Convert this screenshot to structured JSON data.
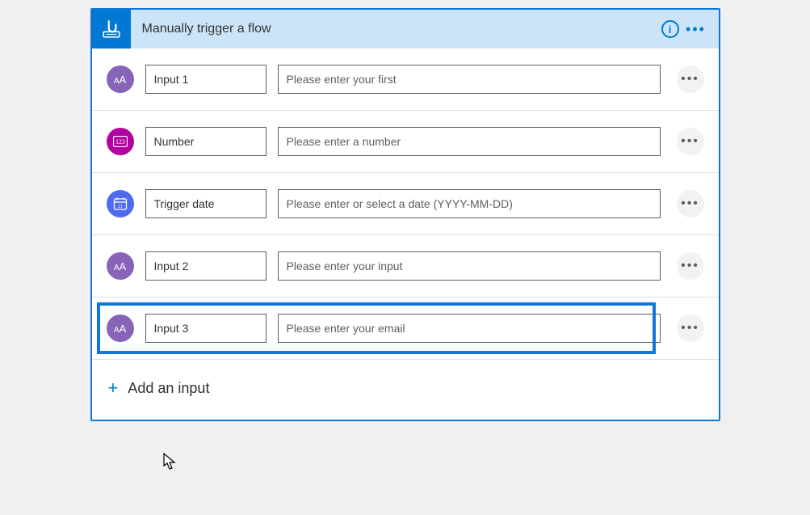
{
  "header": {
    "title": "Manually trigger a flow"
  },
  "inputs": [
    {
      "icon": "text",
      "name": "Input 1",
      "placeholder": "Please enter your first"
    },
    {
      "icon": "number",
      "name": "Number",
      "placeholder": "Please enter a number"
    },
    {
      "icon": "date",
      "name": "Trigger date",
      "placeholder": "Please enter or select a date (YYYY-MM-DD)"
    },
    {
      "icon": "text",
      "name": "Input 2",
      "placeholder": "Please enter your input"
    },
    {
      "icon": "text",
      "name": "Input 3",
      "placeholder": "Please enter your email",
      "highlighted": true
    }
  ],
  "addLabel": "Add an input"
}
